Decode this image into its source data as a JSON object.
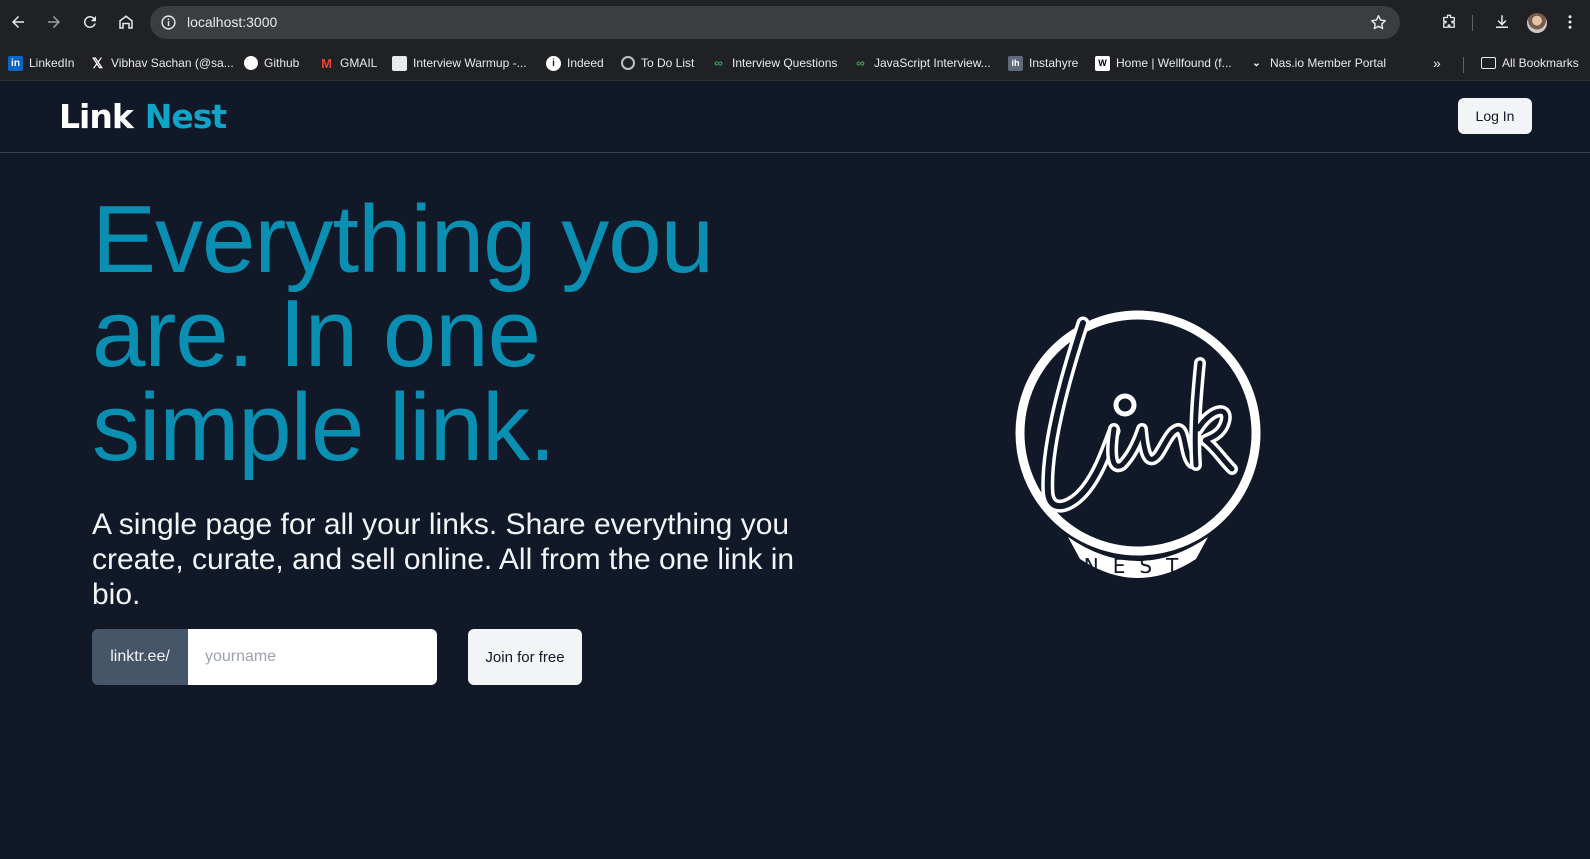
{
  "browser": {
    "url": "localhost:3000",
    "bookmarks": [
      {
        "label": "LinkedIn",
        "icon": "linkedin-icon"
      },
      {
        "label": "Vibhav Sachan (@sa...",
        "icon": "x-twitter-icon"
      },
      {
        "label": "Github",
        "icon": "github-icon"
      },
      {
        "label": "GMAIL",
        "icon": "gmail-icon"
      },
      {
        "label": "Interview Warmup -...",
        "icon": "page-icon"
      },
      {
        "label": "Indeed",
        "icon": "indeed-icon"
      },
      {
        "label": "To Do List",
        "icon": "globe-icon"
      },
      {
        "label": "Interview Questions",
        "icon": "infinity-icon"
      },
      {
        "label": "JavaScript Interview...",
        "icon": "infinity-icon"
      },
      {
        "label": "Instahyre",
        "icon": "instahyre-icon"
      },
      {
        "label": "Home | Wellfound (f...",
        "icon": "wellfound-icon"
      },
      {
        "label": "Nas.io Member Portal",
        "icon": "chevron-icon"
      }
    ],
    "all_bookmarks_label": "All Bookmarks"
  },
  "app": {
    "brand_part1": "Link",
    "brand_part2": "Nest",
    "login_label": "Log In"
  },
  "hero": {
    "title": "Everything you are. In one simple link.",
    "subtitle": "A single page for all your links. Share everything you create, curate, and sell online. All from the one link in bio.",
    "url_prefix": "linktr.ee/",
    "username_placeholder": "yourname",
    "join_label": "Join for free",
    "logo_text": "NEST"
  },
  "colors": {
    "background": "#111827",
    "accent": "#0a8fb3",
    "brand_accent": "#0ea5c9"
  }
}
